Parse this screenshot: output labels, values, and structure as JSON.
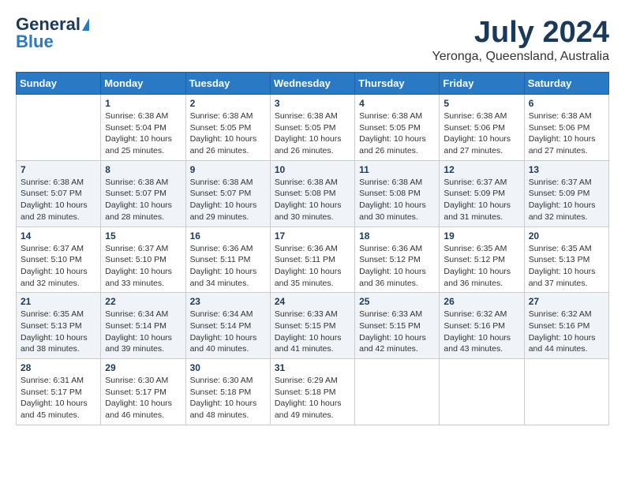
{
  "header": {
    "logo_general": "General",
    "logo_blue": "Blue",
    "title": "July 2024",
    "subtitle": "Yeronga, Queensland, Australia"
  },
  "days_of_week": [
    "Sunday",
    "Monday",
    "Tuesday",
    "Wednesday",
    "Thursday",
    "Friday",
    "Saturday"
  ],
  "weeks": [
    [
      {
        "day": "",
        "info": ""
      },
      {
        "day": "1",
        "info": "Sunrise: 6:38 AM\nSunset: 5:04 PM\nDaylight: 10 hours\nand 25 minutes."
      },
      {
        "day": "2",
        "info": "Sunrise: 6:38 AM\nSunset: 5:05 PM\nDaylight: 10 hours\nand 26 minutes."
      },
      {
        "day": "3",
        "info": "Sunrise: 6:38 AM\nSunset: 5:05 PM\nDaylight: 10 hours\nand 26 minutes."
      },
      {
        "day": "4",
        "info": "Sunrise: 6:38 AM\nSunset: 5:05 PM\nDaylight: 10 hours\nand 26 minutes."
      },
      {
        "day": "5",
        "info": "Sunrise: 6:38 AM\nSunset: 5:06 PM\nDaylight: 10 hours\nand 27 minutes."
      },
      {
        "day": "6",
        "info": "Sunrise: 6:38 AM\nSunset: 5:06 PM\nDaylight: 10 hours\nand 27 minutes."
      }
    ],
    [
      {
        "day": "7",
        "info": "Sunrise: 6:38 AM\nSunset: 5:07 PM\nDaylight: 10 hours\nand 28 minutes."
      },
      {
        "day": "8",
        "info": "Sunrise: 6:38 AM\nSunset: 5:07 PM\nDaylight: 10 hours\nand 28 minutes."
      },
      {
        "day": "9",
        "info": "Sunrise: 6:38 AM\nSunset: 5:07 PM\nDaylight: 10 hours\nand 29 minutes."
      },
      {
        "day": "10",
        "info": "Sunrise: 6:38 AM\nSunset: 5:08 PM\nDaylight: 10 hours\nand 30 minutes."
      },
      {
        "day": "11",
        "info": "Sunrise: 6:38 AM\nSunset: 5:08 PM\nDaylight: 10 hours\nand 30 minutes."
      },
      {
        "day": "12",
        "info": "Sunrise: 6:37 AM\nSunset: 5:09 PM\nDaylight: 10 hours\nand 31 minutes."
      },
      {
        "day": "13",
        "info": "Sunrise: 6:37 AM\nSunset: 5:09 PM\nDaylight: 10 hours\nand 32 minutes."
      }
    ],
    [
      {
        "day": "14",
        "info": "Sunrise: 6:37 AM\nSunset: 5:10 PM\nDaylight: 10 hours\nand 32 minutes."
      },
      {
        "day": "15",
        "info": "Sunrise: 6:37 AM\nSunset: 5:10 PM\nDaylight: 10 hours\nand 33 minutes."
      },
      {
        "day": "16",
        "info": "Sunrise: 6:36 AM\nSunset: 5:11 PM\nDaylight: 10 hours\nand 34 minutes."
      },
      {
        "day": "17",
        "info": "Sunrise: 6:36 AM\nSunset: 5:11 PM\nDaylight: 10 hours\nand 35 minutes."
      },
      {
        "day": "18",
        "info": "Sunrise: 6:36 AM\nSunset: 5:12 PM\nDaylight: 10 hours\nand 36 minutes."
      },
      {
        "day": "19",
        "info": "Sunrise: 6:35 AM\nSunset: 5:12 PM\nDaylight: 10 hours\nand 36 minutes."
      },
      {
        "day": "20",
        "info": "Sunrise: 6:35 AM\nSunset: 5:13 PM\nDaylight: 10 hours\nand 37 minutes."
      }
    ],
    [
      {
        "day": "21",
        "info": "Sunrise: 6:35 AM\nSunset: 5:13 PM\nDaylight: 10 hours\nand 38 minutes."
      },
      {
        "day": "22",
        "info": "Sunrise: 6:34 AM\nSunset: 5:14 PM\nDaylight: 10 hours\nand 39 minutes."
      },
      {
        "day": "23",
        "info": "Sunrise: 6:34 AM\nSunset: 5:14 PM\nDaylight: 10 hours\nand 40 minutes."
      },
      {
        "day": "24",
        "info": "Sunrise: 6:33 AM\nSunset: 5:15 PM\nDaylight: 10 hours\nand 41 minutes."
      },
      {
        "day": "25",
        "info": "Sunrise: 6:33 AM\nSunset: 5:15 PM\nDaylight: 10 hours\nand 42 minutes."
      },
      {
        "day": "26",
        "info": "Sunrise: 6:32 AM\nSunset: 5:16 PM\nDaylight: 10 hours\nand 43 minutes."
      },
      {
        "day": "27",
        "info": "Sunrise: 6:32 AM\nSunset: 5:16 PM\nDaylight: 10 hours\nand 44 minutes."
      }
    ],
    [
      {
        "day": "28",
        "info": "Sunrise: 6:31 AM\nSunset: 5:17 PM\nDaylight: 10 hours\nand 45 minutes."
      },
      {
        "day": "29",
        "info": "Sunrise: 6:30 AM\nSunset: 5:17 PM\nDaylight: 10 hours\nand 46 minutes."
      },
      {
        "day": "30",
        "info": "Sunrise: 6:30 AM\nSunset: 5:18 PM\nDaylight: 10 hours\nand 48 minutes."
      },
      {
        "day": "31",
        "info": "Sunrise: 6:29 AM\nSunset: 5:18 PM\nDaylight: 10 hours\nand 49 minutes."
      },
      {
        "day": "",
        "info": ""
      },
      {
        "day": "",
        "info": ""
      },
      {
        "day": "",
        "info": ""
      }
    ]
  ]
}
